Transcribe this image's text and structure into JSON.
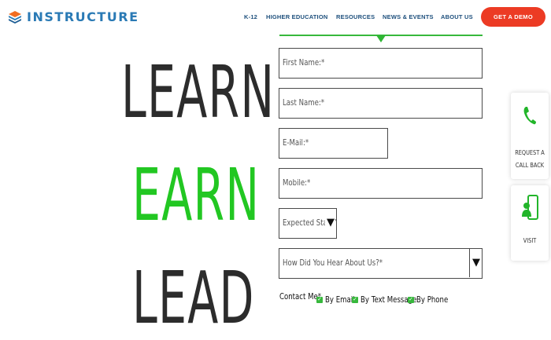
{
  "brand": {
    "name": "INSTRUCTURE"
  },
  "nav": {
    "items": [
      "K-12",
      "HIGHER EDUCATION",
      "RESOURCES",
      "NEWS & EVENTS",
      "ABOUT US"
    ],
    "cta": "GET A DEMO"
  },
  "hero": {
    "line1": "LEARN",
    "line2": "EARN",
    "line3": "LEAD"
  },
  "form": {
    "first_name": "First Name:*",
    "last_name": "Last Name:*",
    "email": "E-Mail:*",
    "mobile": "Mobile:*",
    "start": "Expected Start Y",
    "hear": "How Did You Hear About Us?*",
    "contact_label": "Contact Me*",
    "contact_options": [
      "By Email",
      "By Text Message",
      "By Phone"
    ]
  },
  "side": {
    "callback": [
      "REQUEST A",
      "CALL BACK"
    ],
    "visit": "VISIT"
  },
  "colors": {
    "brand_blue": "#2a7ab5",
    "accent_green": "#22c722",
    "cta_red": "#ec3b24"
  },
  "icons": [
    "logo-icon",
    "phone-icon",
    "visit-icon",
    "chevron-down-icon",
    "checkbox-icon"
  ]
}
